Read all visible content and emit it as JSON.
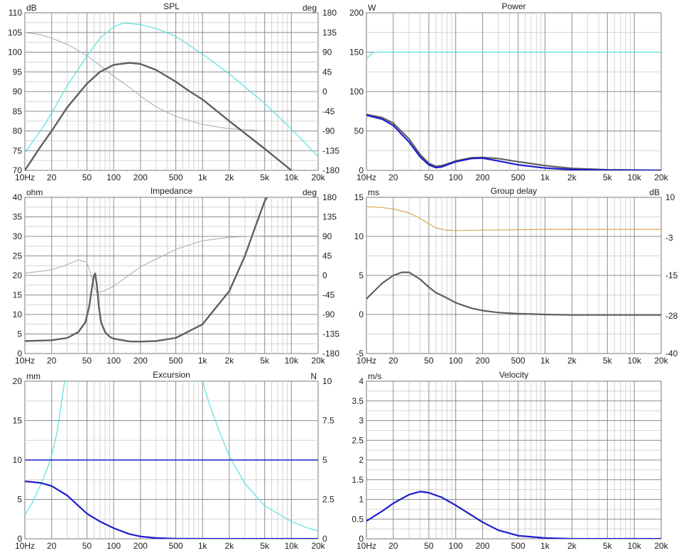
{
  "chart_data": [
    {
      "id": "spl",
      "type": "line",
      "title": "SPL",
      "ylabel": "dB",
      "y2label": "deg",
      "xlabel": "",
      "xscale": "log",
      "xlim": [
        10,
        20000
      ],
      "ylim": [
        70,
        110
      ],
      "y2lim": [
        -180,
        180
      ],
      "x_ticks": [
        10,
        20,
        50,
        100,
        200,
        500,
        1000,
        2000,
        5000,
        10000,
        20000
      ],
      "x_tick_labels": [
        "10Hz",
        "20",
        "50",
        "100",
        "200",
        "500",
        "1k",
        "2k",
        "5k",
        "10k",
        "20k"
      ],
      "y_ticks": [
        70,
        75,
        80,
        85,
        90,
        95,
        100,
        105,
        110
      ],
      "y_tick_labels": [
        "70",
        "75",
        "80",
        "85",
        "90",
        "95",
        "100",
        "105",
        "110"
      ],
      "y2_ticks": [
        -180,
        -135,
        -90,
        -45,
        0,
        45,
        90,
        135,
        180
      ],
      "y2_tick_labels": [
        "-180",
        "-135",
        "-90",
        "-45",
        "0",
        "45",
        "90",
        "135",
        "180"
      ],
      "grid": true,
      "legend": "none",
      "series": [
        {
          "axis": "y2",
          "color": "#b4b4b4",
          "width": 1.2,
          "x": [
            10,
            15,
            20,
            30,
            50,
            70,
            100,
            150,
            200,
            300,
            500,
            1000,
            2000,
            5000,
            10000
          ],
          "values": [
            135,
            130,
            122,
            108,
            82,
            60,
            35,
            10,
            -10,
            -35,
            -57,
            -75,
            -85,
            -90,
            -90
          ]
        },
        {
          "axis": "y1",
          "color": "#5adfdf",
          "width": 1.2,
          "x": [
            10,
            15,
            20,
            30,
            50,
            70,
            100,
            130,
            200,
            300,
            500,
            1000,
            2000,
            5000,
            10000,
            20000
          ],
          "values": [
            74.5,
            80,
            84.5,
            91.5,
            99,
            103.5,
            106.5,
            107.4,
            107,
            106,
            104,
            99.5,
            94.5,
            87,
            80.5,
            73.5
          ]
        },
        {
          "axis": "y1",
          "color": "#5f5f5f",
          "width": 2.4,
          "x": [
            10,
            15,
            20,
            30,
            50,
            70,
            100,
            150,
            200,
            300,
            500,
            700,
            1000,
            2000,
            5000,
            10000
          ],
          "values": [
            70,
            76,
            80,
            86,
            92,
            95,
            96.8,
            97.3,
            97,
            95.5,
            92.5,
            90.2,
            88,
            82.5,
            75.5,
            70
          ]
        }
      ]
    },
    {
      "id": "power",
      "type": "line",
      "title": "Power",
      "ylabel": "W",
      "y2label": "",
      "xlabel": "",
      "xscale": "log",
      "xlim": [
        10,
        20000
      ],
      "ylim": [
        0,
        200
      ],
      "x_ticks": [
        10,
        20,
        50,
        100,
        200,
        500,
        1000,
        2000,
        5000,
        10000,
        20000
      ],
      "x_tick_labels": [
        "10Hz",
        "20",
        "50",
        "100",
        "200",
        "500",
        "1k",
        "2k",
        "5k",
        "10k",
        "20k"
      ],
      "y_ticks": [
        0,
        50,
        100,
        150,
        200
      ],
      "y_tick_labels": [
        "0",
        "50",
        "100",
        "150",
        "200"
      ],
      "grid": true,
      "legend": "none",
      "series": [
        {
          "axis": "y1",
          "color": "#5adfdf",
          "width": 1.2,
          "x": [
            10,
            12,
            20000
          ],
          "values": [
            142,
            150,
            150
          ]
        },
        {
          "axis": "y1",
          "color": "#5f5f5f",
          "width": 2.2,
          "x": [
            10,
            15,
            20,
            30,
            40,
            50,
            60,
            70,
            80,
            100,
            150,
            200,
            300,
            500,
            1000,
            2000,
            5000,
            20000
          ],
          "values": [
            71,
            67,
            60,
            40,
            20,
            9,
            5,
            6,
            8,
            12,
            16,
            16.5,
            15,
            11,
            6,
            2.5,
            0.8,
            0
          ]
        },
        {
          "axis": "y1",
          "color": "#1b1bd0",
          "width": 2.2,
          "x": [
            10,
            15,
            20,
            30,
            40,
            50,
            60,
            70,
            80,
            100,
            150,
            200,
            300,
            500,
            1000,
            2000,
            5000,
            20000
          ],
          "values": [
            70,
            65,
            57,
            36,
            17,
            7,
            3.5,
            4.5,
            7,
            11,
            15,
            15.5,
            12,
            7,
            3,
            1,
            0.3,
            0
          ]
        }
      ]
    },
    {
      "id": "impedance",
      "type": "line",
      "title": "Impedance",
      "ylabel": "ohm",
      "y2label": "deg",
      "xlabel": "",
      "xscale": "log",
      "xlim": [
        10,
        20000
      ],
      "ylim": [
        0,
        40
      ],
      "y2lim": [
        -180,
        180
      ],
      "x_ticks": [
        10,
        20,
        50,
        100,
        200,
        500,
        1000,
        2000,
        5000,
        10000,
        20000
      ],
      "x_tick_labels": [
        "10Hz",
        "20",
        "50",
        "100",
        "200",
        "500",
        "1k",
        "2k",
        "5k",
        "10k",
        "20k"
      ],
      "y_ticks": [
        0,
        5,
        10,
        15,
        20,
        25,
        30,
        35,
        40
      ],
      "y_tick_labels": [
        "0",
        "5",
        "10",
        "15",
        "20",
        "25",
        "30",
        "35",
        "40"
      ],
      "y2_ticks": [
        -180,
        -135,
        -90,
        -45,
        0,
        45,
        90,
        135,
        180
      ],
      "y2_tick_labels": [
        "-180",
        "-135",
        "-90",
        "-45",
        "0",
        "45",
        "90",
        "135",
        "180"
      ],
      "grid": true,
      "legend": "none",
      "series": [
        {
          "axis": "y2",
          "color": "#b4b4b4",
          "width": 1.2,
          "x": [
            10,
            20,
            30,
            40,
            50,
            55,
            60,
            65,
            70,
            80,
            100,
            200,
            500,
            1000,
            2000,
            5000,
            10000,
            20000
          ],
          "values": [
            5,
            13,
            25,
            36,
            30,
            5,
            -25,
            -40,
            -38,
            -35,
            -25,
            20,
            60,
            80,
            88,
            91,
            91,
            91
          ]
        },
        {
          "axis": "y1",
          "color": "#5f5f5f",
          "width": 2.4,
          "x": [
            10,
            20,
            30,
            40,
            48,
            53,
            57,
            60,
            62,
            65,
            68,
            72,
            80,
            90,
            100,
            150,
            200,
            300,
            500,
            1000,
            2000,
            3000,
            4000,
            5000,
            5300
          ],
          "values": [
            3.2,
            3.4,
            4,
            5.5,
            8,
            12,
            17,
            20,
            20.5,
            17,
            12,
            8,
            5.5,
            4.3,
            3.8,
            3.1,
            3.05,
            3.2,
            4,
            7.5,
            16,
            25,
            33,
            39,
            40
          ]
        }
      ]
    },
    {
      "id": "group_delay",
      "type": "line",
      "title": "Group delay",
      "ylabel": "ms",
      "y2label": "dB",
      "xlabel": "",
      "xscale": "log",
      "xlim": [
        10,
        20000
      ],
      "ylim": [
        -5,
        15
      ],
      "y2lim": [
        -40,
        10
      ],
      "x_ticks": [
        10,
        20,
        50,
        100,
        200,
        500,
        1000,
        2000,
        5000,
        10000,
        20000
      ],
      "x_tick_labels": [
        "10Hz",
        "20",
        "50",
        "100",
        "200",
        "500",
        "1k",
        "2k",
        "5k",
        "10k",
        "20k"
      ],
      "y_ticks": [
        -5,
        0,
        5,
        10,
        15
      ],
      "y_tick_labels": [
        "-5",
        "0",
        "5",
        "10",
        "15"
      ],
      "y2_ticks": [
        -40,
        -28,
        -15,
        -3,
        10
      ],
      "y2_tick_labels": [
        "-40",
        "-28",
        "-15",
        "-3",
        "10"
      ],
      "grid": true,
      "legend": "none",
      "series": [
        {
          "axis": "y1",
          "color": "#d9a84a",
          "width": 1.2,
          "x": [
            10,
            15,
            20,
            30,
            40,
            50,
            60,
            70,
            80,
            100,
            200,
            500,
            1000,
            2000,
            5000,
            10000,
            20000
          ],
          "values": [
            13.8,
            13.7,
            13.5,
            13,
            12.3,
            11.6,
            11.1,
            10.9,
            10.8,
            10.75,
            10.8,
            10.85,
            10.9,
            10.9,
            10.9,
            10.9,
            10.9
          ]
        },
        {
          "axis": "y1",
          "color": "#5f5f5f",
          "width": 2.2,
          "x": [
            10,
            15,
            20,
            25,
            30,
            40,
            50,
            60,
            80,
            100,
            150,
            200,
            300,
            500,
            700,
            1000,
            2000,
            5000,
            20000
          ],
          "values": [
            2,
            4,
            5,
            5.4,
            5.4,
            4.5,
            3.5,
            2.8,
            2.1,
            1.5,
            0.8,
            0.5,
            0.25,
            0.1,
            0.05,
            0,
            -0.05,
            -0.05,
            -0.05
          ]
        }
      ]
    },
    {
      "id": "excursion",
      "type": "line",
      "title": "Excursion",
      "ylabel": "mm",
      "y2label": "N",
      "xlabel": "",
      "xscale": "log",
      "xlim": [
        10,
        20000
      ],
      "ylim": [
        0,
        20
      ],
      "y2lim": [
        0,
        10
      ],
      "x_ticks": [
        10,
        20,
        50,
        100,
        200,
        500,
        1000,
        2000,
        5000,
        10000,
        20000
      ],
      "x_tick_labels": [
        "10Hz",
        "20",
        "50",
        "100",
        "200",
        "500",
        "1k",
        "2k",
        "5k",
        "10k",
        "20k"
      ],
      "y_ticks": [
        0,
        5,
        10,
        15,
        20
      ],
      "y_tick_labels": [
        "0",
        "5",
        "10",
        "15",
        "20"
      ],
      "y2_ticks": [
        0,
        2.5,
        5,
        7.5,
        10
      ],
      "y2_tick_labels": [
        "0",
        "2.5",
        "5",
        "7.5",
        "10"
      ],
      "grid": true,
      "legend": "none",
      "series": [
        {
          "axis": "y1",
          "color": "#5adfdf",
          "width": 1.2,
          "x": [
            10,
            12,
            15,
            18,
            20,
            23,
            26,
            28
          ],
          "values": [
            3,
            4.5,
            6.8,
            9,
            10.5,
            13.5,
            17.5,
            20
          ]
        },
        {
          "axis": "y1",
          "color": "#5adfdf",
          "width": 1.2,
          "x": [
            1000,
            1200,
            1500,
            2000,
            3000,
            5000,
            10000,
            15000,
            20000
          ],
          "values": [
            20,
            17,
            14,
            10.5,
            7,
            4.2,
            2.2,
            1.4,
            1
          ]
        },
        {
          "axis": "y1",
          "color": "#1b1bd0",
          "width": 1.5,
          "x": [
            10,
            20000
          ],
          "values": [
            10,
            10
          ]
        },
        {
          "axis": "y1",
          "color": "#1b1bd0",
          "width": 2.2,
          "x": [
            10,
            15,
            20,
            30,
            40,
            50,
            70,
            100,
            150,
            200,
            300,
            500,
            1000,
            20000
          ],
          "values": [
            7.3,
            7.1,
            6.7,
            5.5,
            4.2,
            3.2,
            2.2,
            1.35,
            0.6,
            0.3,
            0.1,
            0.02,
            0,
            0
          ]
        }
      ]
    },
    {
      "id": "velocity",
      "type": "line",
      "title": "Velocity",
      "ylabel": "m/s",
      "y2label": "",
      "xlabel": "",
      "xscale": "log",
      "xlim": [
        10,
        20000
      ],
      "ylim": [
        0,
        4
      ],
      "x_ticks": [
        10,
        20,
        50,
        100,
        200,
        500,
        1000,
        2000,
        5000,
        10000,
        20000
      ],
      "x_tick_labels": [
        "10Hz",
        "20",
        "50",
        "100",
        "200",
        "500",
        "1k",
        "2k",
        "5k",
        "10k",
        "20k"
      ],
      "y_ticks": [
        0,
        0.5,
        1,
        1.5,
        2,
        2.5,
        3,
        3.5,
        4
      ],
      "y_tick_labels": [
        "0",
        "0.5",
        "1",
        "1.5",
        "2",
        "2.5",
        "3",
        "3.5",
        "4"
      ],
      "grid": true,
      "legend": "none",
      "series": [
        {
          "axis": "y1",
          "color": "#1b1bd0",
          "width": 2.2,
          "x": [
            10,
            15,
            20,
            30,
            40,
            50,
            70,
            100,
            150,
            200,
            300,
            500,
            1000,
            2000,
            20000
          ],
          "values": [
            0.45,
            0.7,
            0.9,
            1.12,
            1.2,
            1.17,
            1.05,
            0.85,
            0.6,
            0.42,
            0.22,
            0.08,
            0.02,
            0,
            0
          ]
        }
      ]
    }
  ]
}
